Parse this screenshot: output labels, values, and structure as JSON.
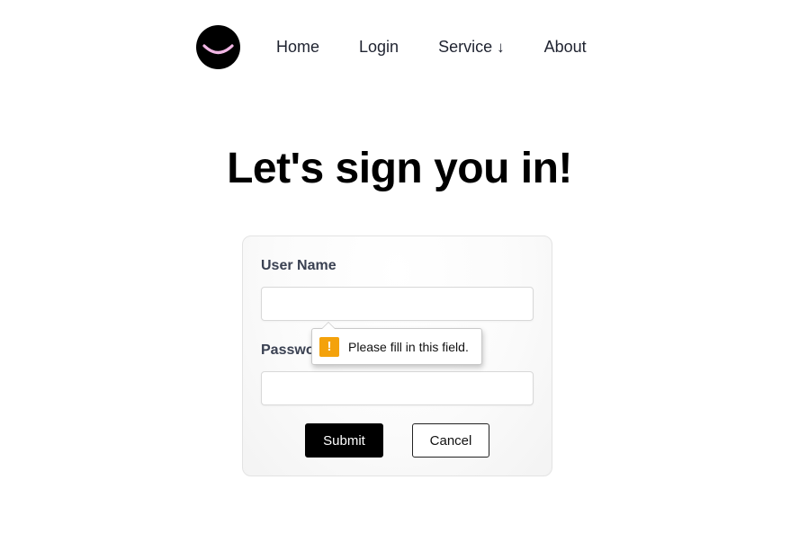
{
  "nav": {
    "logo_icon": "smiley-logo",
    "items": [
      {
        "label": "Home"
      },
      {
        "label": "Login"
      },
      {
        "label": "Service",
        "icon": "↓"
      },
      {
        "label": "About"
      }
    ]
  },
  "main": {
    "heading": "Let's sign you in!"
  },
  "form": {
    "username_label": "User Name",
    "username_value": "",
    "password_label": "Password",
    "password_value": "",
    "submit_label": "Submit",
    "cancel_label": "Cancel"
  },
  "validation": {
    "icon": "warning-icon",
    "icon_glyph": "!",
    "message": "Please fill in this field."
  },
  "colors": {
    "accent": "#000000",
    "warning": "#f4a20b",
    "logo_smile": "#f1b6e4"
  }
}
